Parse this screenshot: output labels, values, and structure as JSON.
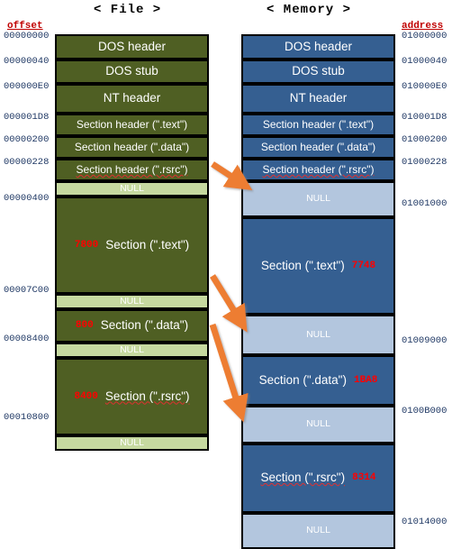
{
  "diagram": {
    "file_column_title": "< File >",
    "memory_column_title": "< Memory >",
    "offset_caption": "offset",
    "address_caption": "address",
    "accent_red": "#ff0000",
    "file_block_color": "#4f5f23",
    "file_null_color": "#c6d9a0",
    "memory_block_color": "#355f91",
    "memory_null_color": "#b3c6de",
    "arrow_color": "#ed7d31"
  },
  "file": {
    "blocks": [
      {
        "label": "DOS header",
        "kind": "solid"
      },
      {
        "label": "DOS stub",
        "kind": "solid"
      },
      {
        "label": "NT header",
        "kind": "solid"
      },
      {
        "label": "Section header (\".text\")",
        "kind": "solid"
      },
      {
        "label": "Section header (\".data\")",
        "kind": "solid"
      },
      {
        "label": "Section header (\".rsrc\")",
        "kind": "solid"
      },
      {
        "label": "NULL",
        "kind": "null"
      },
      {
        "label": "Section (\".text\")",
        "size": "7800",
        "kind": "solid"
      },
      {
        "label": "NULL",
        "kind": "null"
      },
      {
        "label": "Section (\".data\")",
        "size": "800",
        "kind": "solid"
      },
      {
        "label": "NULL",
        "kind": "null"
      },
      {
        "label": "Section (\".rsrc\")",
        "size": "8400",
        "kind": "solid"
      },
      {
        "label": "NULL",
        "kind": "null"
      }
    ],
    "offsets": [
      "00000000",
      "00000040",
      "000000E0",
      "000001D8",
      "00000200",
      "00000228",
      "00000400",
      "00007C00",
      "00008400",
      "00010800"
    ]
  },
  "memory": {
    "blocks": [
      {
        "label": "DOS header",
        "kind": "solid"
      },
      {
        "label": "DOS stub",
        "kind": "solid"
      },
      {
        "label": "NT header",
        "kind": "solid"
      },
      {
        "label": "Section header (\".text\")",
        "kind": "solid"
      },
      {
        "label": "Section header (\".data\")",
        "kind": "solid"
      },
      {
        "label": "Section header (\".rsrc\")",
        "kind": "solid"
      },
      {
        "label": "NULL",
        "kind": "null"
      },
      {
        "label": "Section (\".text\")",
        "size": "7748",
        "kind": "solid"
      },
      {
        "label": "NULL",
        "kind": "null"
      },
      {
        "label": "Section (\".data\")",
        "size": "1BA8",
        "kind": "solid"
      },
      {
        "label": "NULL",
        "kind": "null"
      },
      {
        "label": "Section (\".rsrc\")",
        "size": "8314",
        "kind": "solid"
      },
      {
        "label": "NULL",
        "kind": "null"
      }
    ],
    "addresses": [
      "01000000",
      "01000040",
      "010000E0",
      "010001D8",
      "01000200",
      "01000228",
      "01001000",
      "01009000",
      "0100B000",
      "01014000"
    ]
  }
}
